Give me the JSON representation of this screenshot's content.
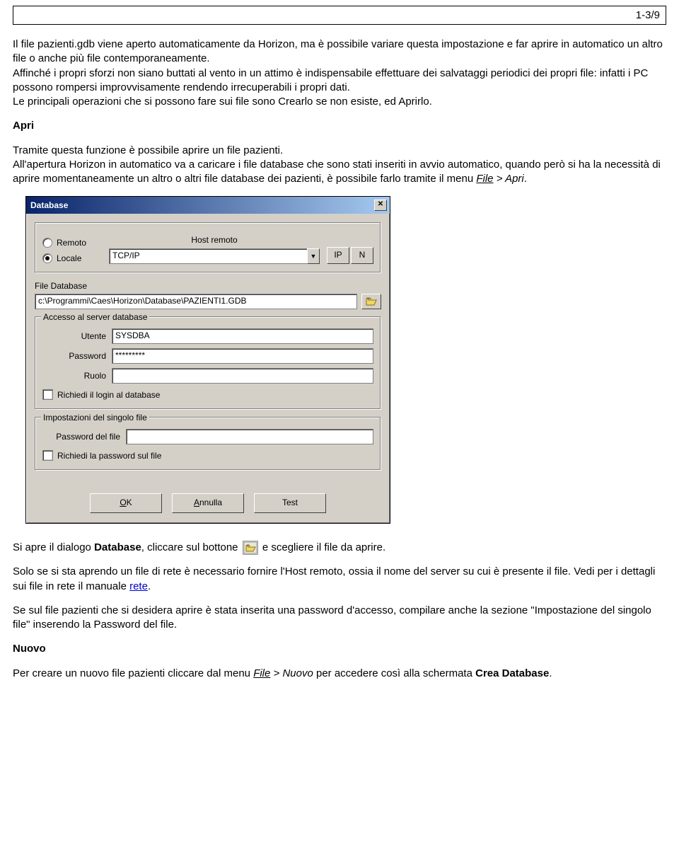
{
  "page_number": "1-3/9",
  "intro_paragraph": "Il file pazienti.gdb viene aperto automaticamente da Horizon, ma è possibile variare questa impostazione e far aprire in automatico un altro file o anche più file contemporaneamente.\nAffinché i propri sforzi non siano buttati al vento in un attimo è indispensabile effettuare dei salvataggi periodici dei propri file: infatti i PC possono rompersi improvvisamente rendendo irrecuperabili i propri dati.\nLe principali operazioni che si possono fare sui file sono Crearlo se non esiste, ed Aprirlo.",
  "apri_heading": "Apri",
  "apri_text_1": "Tramite questa funzione è possibile aprire un file pazienti.",
  "apri_text_2_part1": "All'apertura Horizon in automatico va a caricare i file database che sono stati inseriti in avvio automatico, quando però si ha la necessità di aprire momentaneamente un altro o altri file database dei pazienti, è possibile farlo tramite il menu ",
  "apri_text_2_file": "File",
  "apri_text_2_part2": " > Apri",
  "apri_text_2_end": ".",
  "dialog": {
    "title": "Database",
    "close_glyph": "✕",
    "host_label": "Host remoto",
    "radio_remoto": "Remoto",
    "radio_locale": "Locale",
    "protocol_value": "TCP/IP",
    "ip_btn": "IP",
    "n_btn": "N",
    "file_db_label": "File Database",
    "file_db_value": "c:\\Programmi\\Caes\\Horizon\\Database\\PAZIENTI1.GDB",
    "server_access_legend": "Accesso al server database",
    "utente_label": "Utente",
    "utente_value": "SYSDBA",
    "password_label": "Password",
    "password_value": "*********",
    "ruolo_label": "Ruolo",
    "ruolo_value": "",
    "login_checkbox": "Richiedi il login al database",
    "file_settings_legend": "Impostazioni del singolo file",
    "file_password_label": "Password del file",
    "file_password_value": "",
    "file_pw_checkbox": "Richiedi la password sul file",
    "ok_btn_prefix": "O",
    "ok_btn_rest": "K",
    "cancel_btn_prefix": "A",
    "cancel_btn_rest": "nnulla",
    "test_btn": "Test"
  },
  "after_dialog_1_part1": "Si apre il dialogo ",
  "after_dialog_1_bold": "Database",
  "after_dialog_1_part2": ", cliccare sul bottone ",
  "after_dialog_1_part3": " e scegliere il file da aprire.",
  "after_dialog_2_part1": "Solo se si sta aprendo un file di rete è necessario fornire  l'Host remoto, ossia il nome del server su cui è presente il file. Vedi per i dettagli sui file in rete il manuale ",
  "after_dialog_2_link": "rete",
  "after_dialog_2_end": ".",
  "after_dialog_3": "Se sul file pazienti che si desidera aprire è stata inserita una password d'accesso, compilare anche la sezione \"Impostazione del singolo file\"  inserendo la Password del file.",
  "nuovo_heading": "Nuovo",
  "nuovo_text_part1": "Per creare un nuovo file pazienti cliccare dal menu ",
  "nuovo_text_file": "File",
  "nuovo_text_part2": " > Nuovo",
  "nuovo_text_part3": " per accedere così alla schermata ",
  "nuovo_text_bold": "Crea Database",
  "nuovo_text_end": "."
}
